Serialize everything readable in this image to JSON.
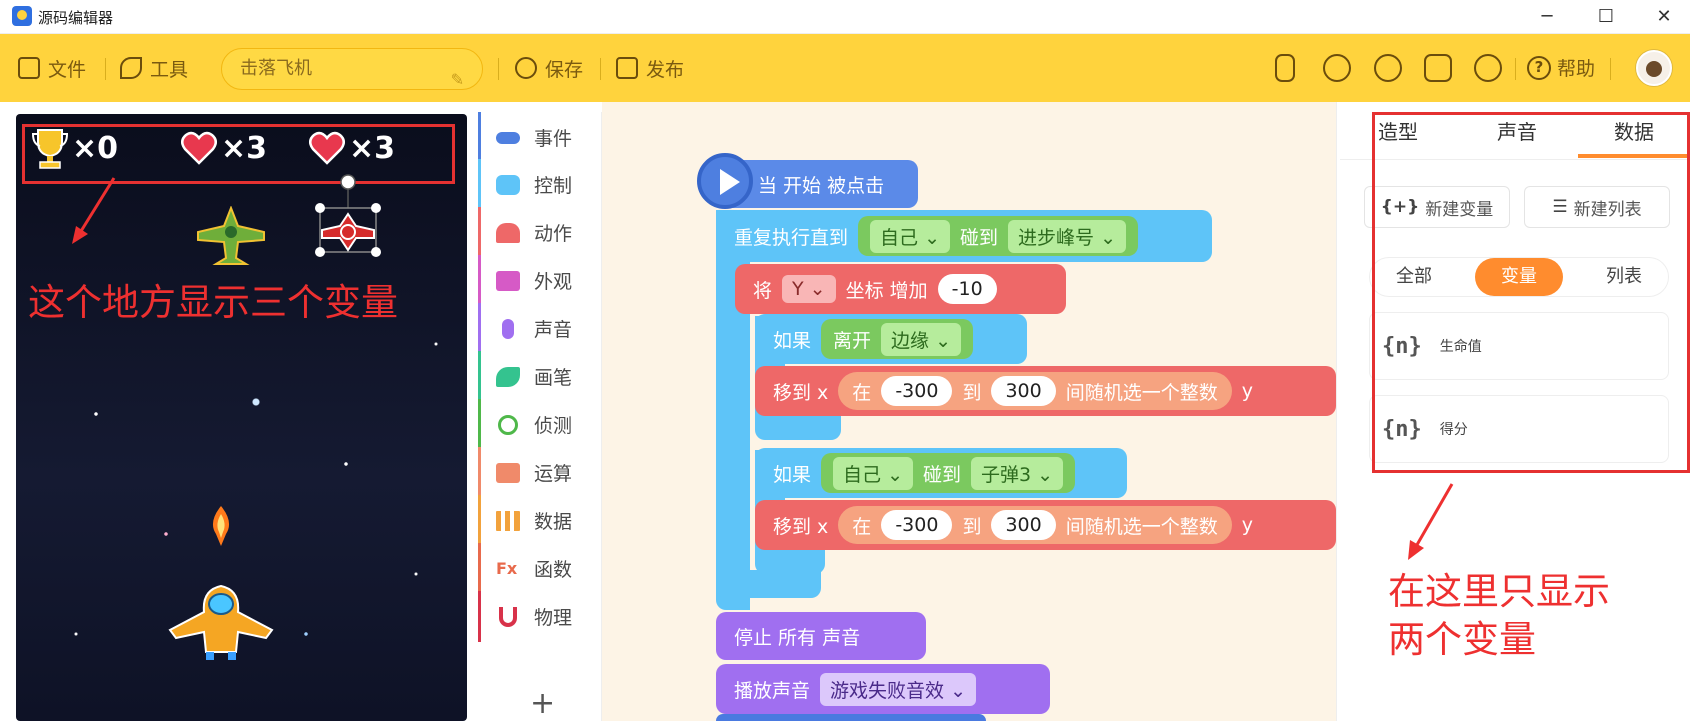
{
  "window": {
    "title": "源码编辑器",
    "minimize": "─",
    "maximize": "☐",
    "close": "✕"
  },
  "toolbar": {
    "file": "文件",
    "tools": "工具",
    "project_name": "击落飞机",
    "save": "保存",
    "publish": "发布",
    "help": "帮助"
  },
  "stage": {
    "hud": [
      {
        "icon": "trophy-icon",
        "text": "×0"
      },
      {
        "icon": "heart-icon",
        "text": "×3"
      },
      {
        "icon": "heart-icon",
        "text": "×3"
      }
    ],
    "annotation": "这个地方显示三个变量"
  },
  "categories": [
    {
      "label": "事件",
      "color": "#4e7fe0"
    },
    {
      "label": "控制",
      "color": "#5ec4f8"
    },
    {
      "label": "动作",
      "color": "#ee6868"
    },
    {
      "label": "外观",
      "color": "#d65ac6"
    },
    {
      "label": "声音",
      "color": "#a06ff0"
    },
    {
      "label": "画笔",
      "color": "#34c38f"
    },
    {
      "label": "侦测",
      "color": "#4fb84a"
    },
    {
      "label": "运算",
      "color": "#f08a6a"
    },
    {
      "label": "数据",
      "color": "#f2a23c"
    },
    {
      "label": "函数",
      "color": "#e86a4c"
    },
    {
      "label": "物理",
      "color": "#d8324a"
    }
  ],
  "add_extension": "+",
  "script": {
    "hat": "当 开始 被点击",
    "repeat_until": "重复执行直到",
    "self_1": "自己",
    "touch_1": "碰到",
    "target_1": "进步峰号",
    "set_label": "将",
    "axis": "Y",
    "coord_increase": "坐标 增加",
    "increase_value": "-10",
    "if_1": "如果",
    "leave": "离开",
    "edge": "边缘",
    "move_x_1": "移到 x",
    "in_1": "在",
    "min_1": "-300",
    "to_1": "到",
    "max_1": "300",
    "random_1": "间随机选一个整数",
    "y_1": "y",
    "if_2": "如果",
    "self_2": "自己",
    "touch_2": "碰到",
    "target_2": "子弹3",
    "move_x_2": "移到 x",
    "in_2": "在",
    "min_2": "-300",
    "to_2": "到",
    "max_2": "300",
    "random_2": "间随机选一个整数",
    "y_2": "y",
    "stop_all_sounds": "停止 所有 声音",
    "play_sound": "播放声音",
    "sound_name": "游戏失败音效"
  },
  "right_panel": {
    "tabs": [
      "造型",
      "声音",
      "数据"
    ],
    "active_tab": "数据",
    "new_variable": "新建变量",
    "new_list": "新建列表",
    "filters": [
      "全部",
      "变量",
      "列表"
    ],
    "active_filter": "变量",
    "variables": [
      {
        "icon": "{n}",
        "name": "生命值"
      },
      {
        "icon": "{n}",
        "name": "得分"
      }
    ],
    "annotation_line1": "在这里只显示",
    "annotation_line2": "两个变量"
  },
  "colors": {
    "toolbar": "#ffd33d",
    "accent": "#ff8c2e",
    "annotation_red": "#e53131"
  }
}
